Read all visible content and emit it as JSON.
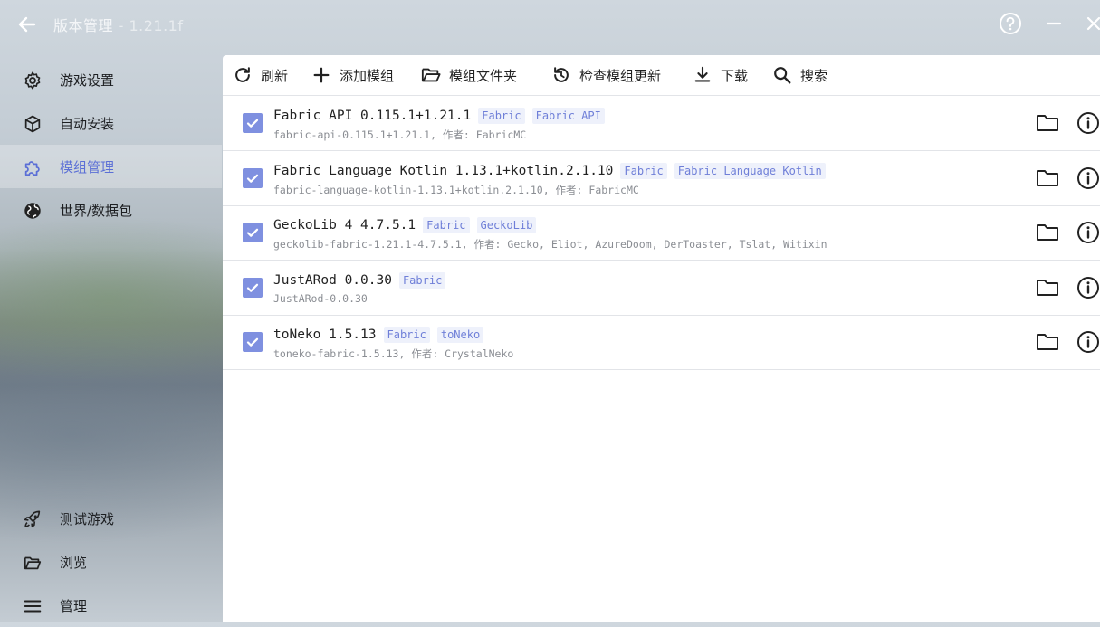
{
  "header": {
    "title": "版本管理",
    "version": " - 1.21.1f"
  },
  "sidebar": {
    "items": [
      {
        "label": "游戏设置",
        "icon": "gear-icon"
      },
      {
        "label": "自动安装",
        "icon": "cube-icon"
      },
      {
        "label": "模组管理",
        "icon": "puzzle-icon",
        "active": true
      },
      {
        "label": "世界/数据包",
        "icon": "globe-icon"
      }
    ],
    "bottom_items": [
      {
        "label": "测试游戏",
        "icon": "rocket-icon"
      },
      {
        "label": "浏览",
        "icon": "folder-open-icon"
      },
      {
        "label": "管理",
        "icon": "menu-icon"
      }
    ]
  },
  "toolbar": {
    "refresh": "刷新",
    "add_mod": "添加模组",
    "mod_folder": "模组文件夹",
    "check_updates": "检查模组更新",
    "download": "下载",
    "search": "搜索"
  },
  "mods": [
    {
      "name": "Fabric API 0.115.1+1.21.1",
      "tags": [
        "Fabric",
        "Fabric API"
      ],
      "sub": "fabric-api-0.115.1+1.21.1, 作者: FabricMC",
      "enabled": true
    },
    {
      "name": "Fabric Language Kotlin 1.13.1+kotlin.2.1.10",
      "tags": [
        "Fabric",
        "Fabric Language Kotlin"
      ],
      "sub": "fabric-language-kotlin-1.13.1+kotlin.2.1.10, 作者: FabricMC",
      "enabled": true
    },
    {
      "name": "GeckoLib 4 4.7.5.1",
      "tags": [
        "Fabric",
        "GeckoLib"
      ],
      "sub": "geckolib-fabric-1.21.1-4.7.5.1, 作者: Gecko, Eliot, AzureDoom, DerToaster, Tslat, Witixin",
      "enabled": true
    },
    {
      "name": "JustARod 0.0.30",
      "tags": [
        "Fabric"
      ],
      "sub": "JustARod-0.0.30",
      "enabled": true
    },
    {
      "name": "toNeko 1.5.13",
      "tags": [
        "Fabric",
        "toNeko"
      ],
      "sub": "toneko-fabric-1.5.13, 作者: CrystalNeko",
      "enabled": true
    }
  ],
  "colors": {
    "accent": "#5b6fd6",
    "checkbox": "#7f90e0",
    "tag_bg": "#eef1fb",
    "tag_text": "#6f7fd8"
  }
}
